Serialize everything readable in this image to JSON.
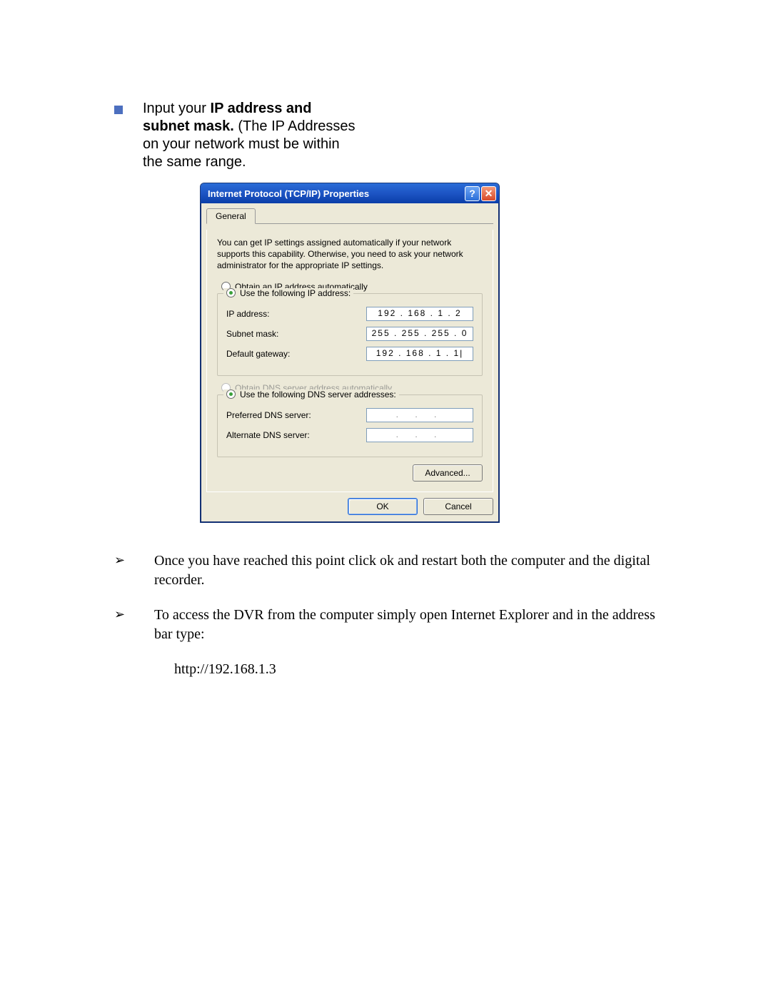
{
  "doc": {
    "top_bullet_html_prefix": "Input your ",
    "top_bullet_bold": "IP address and subnet mask.",
    "top_bullet_suffix": " (The IP Addresses on your network must be within the same range."
  },
  "dialog": {
    "title": "Internet Protocol (TCP/IP) Properties",
    "help_glyph": "?",
    "close_glyph": "✕",
    "tab_general": "General",
    "explain": "You can get IP settings assigned automatically if your network supports this capability. Otherwise, you need to ask your network administrator for the appropriate IP settings.",
    "radio_auto_ip": "Obtain an IP address automatically",
    "radio_use_ip": "Use the following IP address:",
    "ip_label": "IP address:",
    "ip_value": "192 . 168 .   1   .   2",
    "subnet_label": "Subnet mask:",
    "subnet_value": "255 . 255 . 255 .   0",
    "gateway_label": "Default gateway:",
    "gateway_value": "192 . 168 .   1   .   1|",
    "radio_auto_dns": "Obtain DNS server address automatically",
    "radio_use_dns": "Use the following DNS server addresses:",
    "pref_dns_label": "Preferred DNS server:",
    "pref_dns_value": ".   .   .",
    "alt_dns_label": "Alternate DNS server:",
    "alt_dns_value": ".   .   .",
    "advanced_btn": "Advanced...",
    "ok_btn": "OK",
    "cancel_btn": "Cancel"
  },
  "instructions": {
    "item1": "Once you have reached this point click ok and restart both the computer and the digital recorder.",
    "item2": "To access the DVR from the computer simply open Internet Explorer and in the address bar type:",
    "address": "http://192.168.1.3"
  }
}
